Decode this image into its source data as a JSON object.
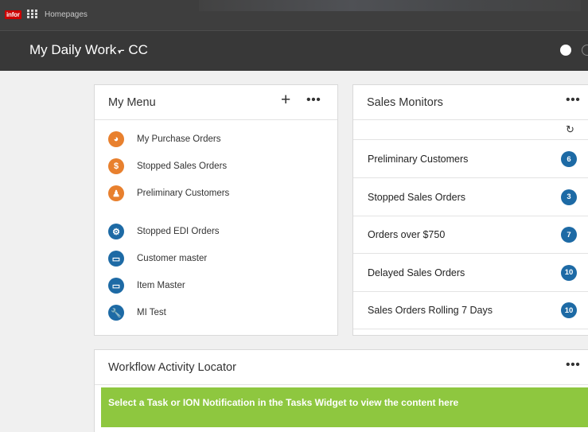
{
  "topbar": {
    "logo": "infor",
    "breadcrumb": "Homepages"
  },
  "header": {
    "title": "My Daily Work - CC",
    "caret": "▾"
  },
  "my_menu": {
    "title": "My Menu",
    "add": "+",
    "more": "•••",
    "items": [
      {
        "label": "My Purchase Orders",
        "icon": "globe-icon",
        "color": "#e8802e",
        "glyph": "◕"
      },
      {
        "label": "Stopped Sales Orders",
        "icon": "dollar-icon",
        "color": "#e8802e",
        "glyph": "$"
      },
      {
        "label": "Preliminary Customers",
        "icon": "user-icon",
        "color": "#e8802e",
        "glyph": "♟"
      },
      {
        "label": "Stopped EDI Orders",
        "icon": "gears-icon",
        "color": "#1d6aa5",
        "glyph": "⚙"
      },
      {
        "label": "Customer master",
        "icon": "window-icon",
        "color": "#1d6aa5",
        "glyph": "▭"
      },
      {
        "label": "Item Master",
        "icon": "window-icon",
        "color": "#1d6aa5",
        "glyph": "▭"
      },
      {
        "label": "MI Test",
        "icon": "wrench-icon",
        "color": "#1d6aa5",
        "glyph": "🔧"
      }
    ]
  },
  "sales_monitors": {
    "title": "Sales Monitors",
    "more": "•••",
    "refresh": "↻",
    "rows": [
      {
        "label": "Preliminary Customers",
        "count": "6"
      },
      {
        "label": "Stopped Sales Orders",
        "count": "3"
      },
      {
        "label": "Orders over $750",
        "count": "7"
      },
      {
        "label": "Delayed Sales Orders",
        "count": "10"
      },
      {
        "label": "Sales Orders Rolling 7 Days",
        "count": "10"
      }
    ]
  },
  "workflow": {
    "title": "Workflow Activity Locator",
    "more": "•••",
    "notice": "Select a Task or ION Notification in the Tasks Widget to view the content here"
  },
  "colors": {
    "accent_orange": "#e8802e",
    "accent_blue": "#1d6aa5",
    "notice_green": "#8ec73f",
    "header_bg": "#383838"
  }
}
